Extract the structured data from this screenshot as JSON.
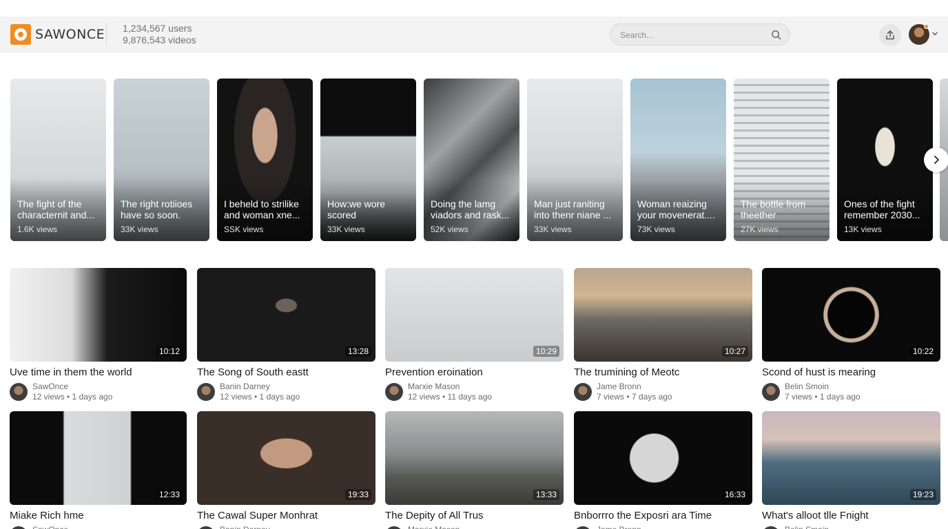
{
  "header": {
    "brand": "SAWONCE",
    "users": "1,234,567 users",
    "videos": "9,876,543 videos",
    "search_placeholder": "Search...",
    "upload_icon": "upload-icon",
    "search_icon": "search-icon",
    "accent_color": "#f08c22"
  },
  "shorts": [
    {
      "title": "The fight of the characternit and...",
      "views": "1.6K views"
    },
    {
      "title": "The right rotiioes have so soon.",
      "views": "33K views"
    },
    {
      "title": "I beheld to strilike and woman xne...",
      "views": "SSK views"
    },
    {
      "title": "How:we wore scored",
      "views": "33K views"
    },
    {
      "title": "Doing the lamg viadors and rask...",
      "views": "52K views"
    },
    {
      "title": "Man just raniting into thenr niane ...",
      "views": "33K views"
    },
    {
      "title": "Woman reaizing your movenerat....",
      "views": "73K views"
    },
    {
      "title": "The bottle from theether",
      "views": "27K views"
    },
    {
      "title": "Ones of the fight remember 2030...",
      "views": "13K views"
    }
  ],
  "videos": [
    {
      "title": "Uve time in them the world",
      "channel": "SawOnce",
      "stats": "12 views • 1 days ago",
      "duration": "10:12"
    },
    {
      "title": "The Song of South eastt",
      "channel": "Banin Darney",
      "stats": "12 views • 1 days ago",
      "duration": "13:28"
    },
    {
      "title": "Prevention eroination",
      "channel": "Marxie Mason",
      "stats": "12 views • 11 days ago",
      "duration": "10:29"
    },
    {
      "title": "The trumining of Meotc",
      "channel": "Jame Bronn",
      "stats": "7 views • 7 days ago",
      "duration": "10:27"
    },
    {
      "title": "Scond of hust is mearing",
      "channel": "Belin Smoin",
      "stats": "7 views • 1 days ago",
      "duration": "10:22"
    },
    {
      "title": "Miake Rich hme",
      "channel": "SawOnce",
      "stats": "",
      "duration": "12:33"
    },
    {
      "title": "The Cawal Super Monhrat",
      "channel": "Banin Darney",
      "stats": "",
      "duration": "19:33"
    },
    {
      "title": "The Depity of All Trus",
      "channel": "Marxie Mason",
      "stats": "",
      "duration": "13:33"
    },
    {
      "title": "Bnborrro the Exposri ara Time",
      "channel": "Jame Bronn",
      "stats": "",
      "duration": "16:33"
    },
    {
      "title": "What's alloot tlle Fnight",
      "channel": "Belin Smain",
      "stats": "",
      "duration": "19:23"
    }
  ]
}
